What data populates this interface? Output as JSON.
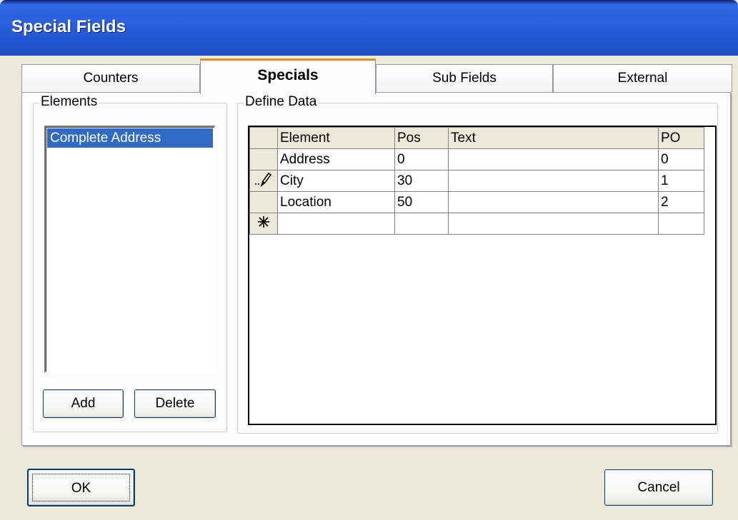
{
  "window": {
    "title": "Special Fields"
  },
  "tabs": [
    {
      "label": "Counters",
      "active": false
    },
    {
      "label": "Specials",
      "active": true
    },
    {
      "label": "Sub Fields",
      "active": false
    },
    {
      "label": "External",
      "active": false
    }
  ],
  "elements_group": {
    "label": "Elements",
    "items": [
      "Complete Address"
    ],
    "selected": "Complete Address",
    "add_label": "Add",
    "delete_label": "Delete"
  },
  "define_data": {
    "label": "Define Data",
    "columns": [
      "Element",
      "Pos",
      "Text",
      "PO"
    ],
    "rows": [
      {
        "marker": "",
        "element": "Address",
        "pos": "0",
        "text": "",
        "po": "0"
      },
      {
        "marker": "pencil",
        "element": "City",
        "pos": "30",
        "text": "",
        "po": "1"
      },
      {
        "marker": "",
        "element": "Location",
        "pos": "50",
        "text": "",
        "po": "2"
      }
    ],
    "new_row_marker": "*"
  },
  "footer": {
    "ok_label": "OK",
    "cancel_label": "Cancel"
  },
  "colors": {
    "selection": "#316ac5",
    "title_bar": "#2a5fdc",
    "active_tab_accent": "#e68b2c"
  }
}
